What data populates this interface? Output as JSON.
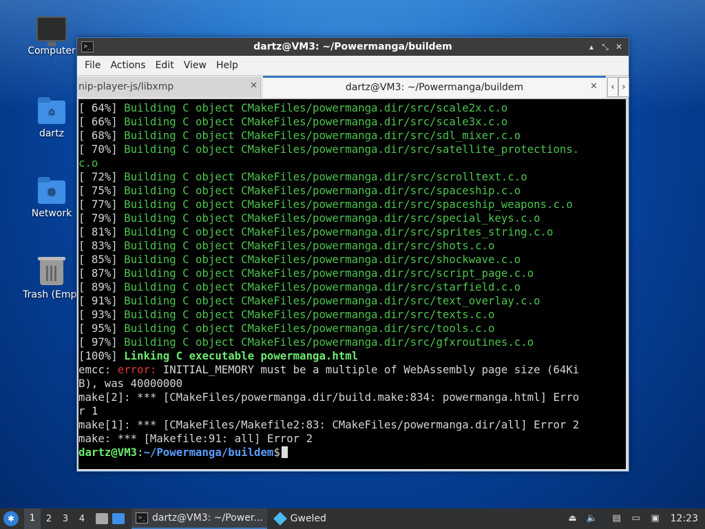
{
  "desktop": {
    "icons": [
      {
        "label": "Computer",
        "icon": "computer-icon"
      },
      {
        "label": "dartz",
        "icon": "home-folder-icon"
      },
      {
        "label": "Network",
        "icon": "network-folder-icon"
      },
      {
        "label": "Trash (Empt",
        "icon": "trash-icon"
      }
    ]
  },
  "window": {
    "title": "dartz@VM3: ~/Powermanga/buildem",
    "menu": [
      "File",
      "Actions",
      "Edit",
      "View",
      "Help"
    ],
    "tabs": [
      {
        "label": "nip-player-js/libxmp",
        "active": false
      },
      {
        "label": "dartz@VM3: ~/Powermanga/buildem",
        "active": true
      }
    ],
    "controls": {
      "minimize": "▴",
      "maximize": "⤡",
      "close": "✕"
    }
  },
  "terminal": {
    "lines": [
      {
        "pct": "[ 64%] ",
        "msg": "Building C object CMakeFiles/powermanga.dir/src/scale2x.c.o"
      },
      {
        "pct": "[ 66%] ",
        "msg": "Building C object CMakeFiles/powermanga.dir/src/scale3x.c.o"
      },
      {
        "pct": "[ 68%] ",
        "msg": "Building C object CMakeFiles/powermanga.dir/src/sdl_mixer.c.o"
      },
      {
        "pct": "[ 70%] ",
        "msg": "Building C object CMakeFiles/powermanga.dir/src/satellite_protections."
      },
      {
        "pct": "",
        "msg": "c.o"
      },
      {
        "pct": "[ 72%] ",
        "msg": "Building C object CMakeFiles/powermanga.dir/src/scrolltext.c.o"
      },
      {
        "pct": "[ 75%] ",
        "msg": "Building C object CMakeFiles/powermanga.dir/src/spaceship.c.o"
      },
      {
        "pct": "[ 77%] ",
        "msg": "Building C object CMakeFiles/powermanga.dir/src/spaceship_weapons.c.o"
      },
      {
        "pct": "[ 79%] ",
        "msg": "Building C object CMakeFiles/powermanga.dir/src/special_keys.c.o"
      },
      {
        "pct": "[ 81%] ",
        "msg": "Building C object CMakeFiles/powermanga.dir/src/sprites_string.c.o"
      },
      {
        "pct": "[ 83%] ",
        "msg": "Building C object CMakeFiles/powermanga.dir/src/shots.c.o"
      },
      {
        "pct": "[ 85%] ",
        "msg": "Building C object CMakeFiles/powermanga.dir/src/shockwave.c.o"
      },
      {
        "pct": "[ 87%] ",
        "msg": "Building C object CMakeFiles/powermanga.dir/src/script_page.c.o"
      },
      {
        "pct": "[ 89%] ",
        "msg": "Building C object CMakeFiles/powermanga.dir/src/starfield.c.o"
      },
      {
        "pct": "[ 91%] ",
        "msg": "Building C object CMakeFiles/powermanga.dir/src/text_overlay.c.o"
      },
      {
        "pct": "[ 93%] ",
        "msg": "Building C object CMakeFiles/powermanga.dir/src/texts.c.o"
      },
      {
        "pct": "[ 95%] ",
        "msg": "Building C object CMakeFiles/powermanga.dir/src/tools.c.o"
      },
      {
        "pct": "[ 97%] ",
        "msg": "Building C object CMakeFiles/powermanga.dir/src/gfxroutines.c.o"
      }
    ],
    "link_line": {
      "pct": "[100%] ",
      "msg": "Linking C executable powermanga.html"
    },
    "error_prefix": "emcc: ",
    "error_word": "error:",
    "error_rest": " INITIAL_MEMORY must be a multiple of WebAssembly page size (64Ki",
    "error_rest2": "B), was 40000000",
    "make_lines": [
      "make[2]: *** [CMakeFiles/powermanga.dir/build.make:834: powermanga.html] Erro",
      "r 1",
      "make[1]: *** [CMakeFiles/Makefile2:83: CMakeFiles/powermanga.dir/all] Error 2",
      "make: *** [Makefile:91: all] Error 2"
    ],
    "prompt_user": "dartz@VM3",
    "prompt_sep": ":",
    "prompt_path": "~/Powermanga/buildem",
    "prompt_end": "$"
  },
  "taskbar": {
    "workspaces": [
      "1",
      "2",
      "3",
      "4"
    ],
    "active_workspace": "1",
    "tasks": [
      {
        "label": "dartz@VM3: ~/Power...",
        "active": true
      },
      {
        "label": "Gweled",
        "active": false
      }
    ],
    "clock": "12:23"
  },
  "colors": {
    "accent": "#3a78c2",
    "terminal_bg": "#000000",
    "green": "#4ec44e",
    "error": "#e03c3c"
  }
}
